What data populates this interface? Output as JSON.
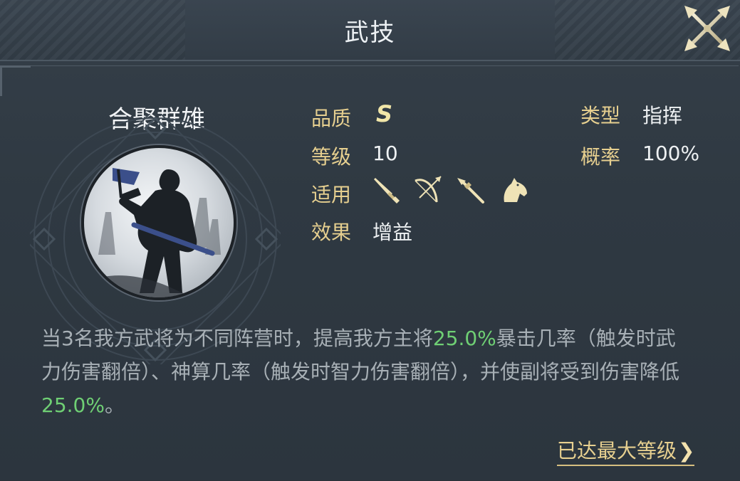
{
  "header": {
    "title": "武技"
  },
  "skill": {
    "name": "合聚群雄",
    "quality_label": "品质",
    "quality_value": "S",
    "level_label": "等级",
    "level_value": "10",
    "applies_label": "适用",
    "applies_icons": [
      "sword-icon",
      "bow-icon",
      "spear-icon",
      "horse-icon"
    ],
    "effect_label": "效果",
    "effect_value": "增益",
    "type_label": "类型",
    "type_value": "指挥",
    "rate_label": "概率",
    "rate_value": "100%"
  },
  "description": {
    "part1": "当3名我方武将为不同阵营时，提高我方主将",
    "value1": "25.0%",
    "part2": "暴击几率（触发时武力伤害翻倍）、神算几率（触发时智力伤害翻倍），并使副将受到伤害降低",
    "value2": "25.0%",
    "part3": "。"
  },
  "footer": {
    "max_level_label": "已达最大等级",
    "chevron": "❯"
  },
  "colors": {
    "label_gold": "#e6cf8f",
    "highlight_green": "#6fcf74",
    "body_text": "#a8b0b6"
  }
}
